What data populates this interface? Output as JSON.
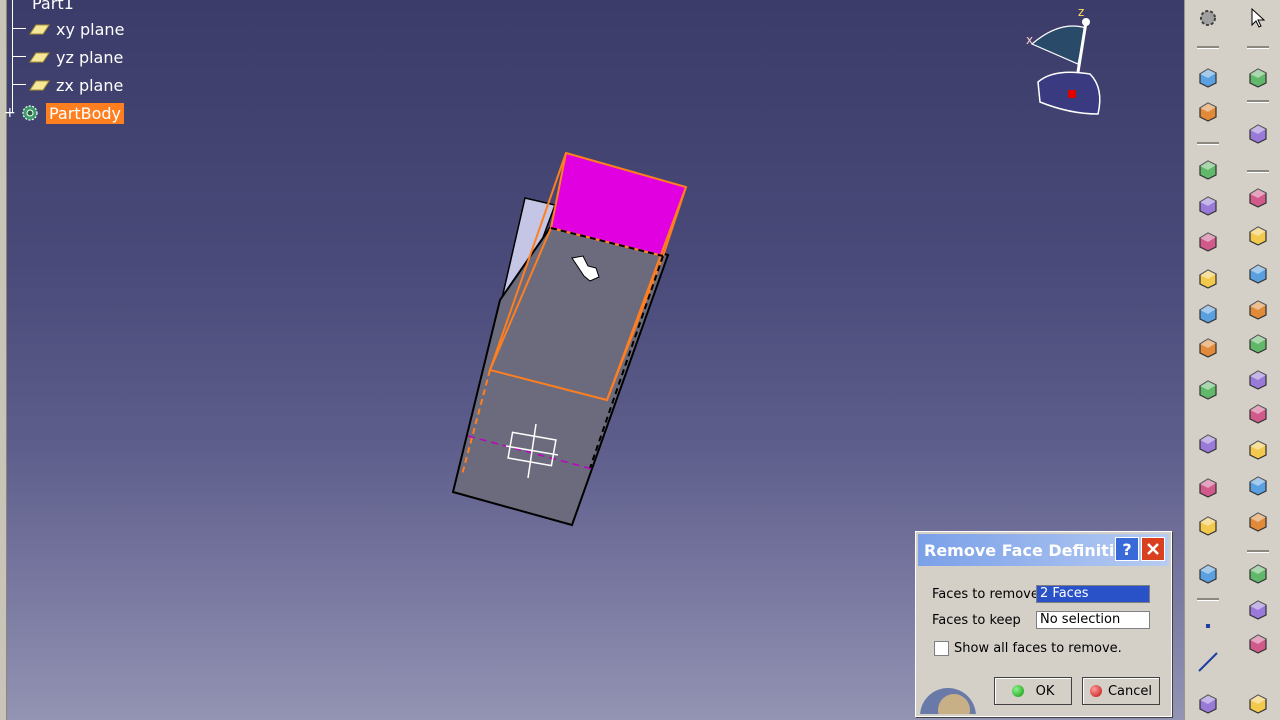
{
  "tree": {
    "root_label": "Part1",
    "items": [
      {
        "label": "xy plane",
        "icon": "plane-icon"
      },
      {
        "label": "yz plane",
        "icon": "plane-icon"
      },
      {
        "label": "zx plane",
        "icon": "plane-icon"
      },
      {
        "label": "PartBody",
        "icon": "partbody-gear-icon"
      }
    ]
  },
  "compass": {
    "x_label": "x",
    "z_label": "z"
  },
  "dialog": {
    "title": "Remove Face Definition",
    "help_label": "?",
    "faces_to_remove_label": "Faces to remove",
    "faces_to_remove_value": "2 Faces",
    "faces_to_keep_label": "Faces to keep",
    "faces_to_keep_value": "No selection",
    "show_all_label": "Show all faces to remove.",
    "ok_label": "OK",
    "cancel_label": "Cancel"
  },
  "colors": {
    "selected_face": "#e000e0",
    "highlight_edge": "#ff7f20",
    "partbody_highlight": "#ff7f20"
  },
  "toolbar": {
    "column1": [
      "gear-icon",
      "sketch-tools-icon",
      "view-icon",
      "pad-icon",
      "pocket-icon",
      "shaft-icon",
      "rib-icon",
      "multi-section-icon",
      "point-target-icon",
      "remove-face-icon",
      "constraint-icon",
      "measure-icon",
      "grid-icon",
      "analysis-icon",
      "point-icon",
      "line-icon",
      "plane-icon"
    ],
    "column2": [
      "select-arrow-icon",
      "sketcher-icon",
      "surface-icon",
      "hole-icon",
      "groove-icon",
      "stiffener-icon",
      "thickness-icon",
      "shell-icon",
      "draft-icon",
      "chamfer-icon",
      "box-icon",
      "fillet-icon",
      "edge-fillet-icon",
      "boolean-add-icon",
      "boolean-remove-icon",
      "boolean-intersect-icon",
      "solid-icon"
    ]
  }
}
